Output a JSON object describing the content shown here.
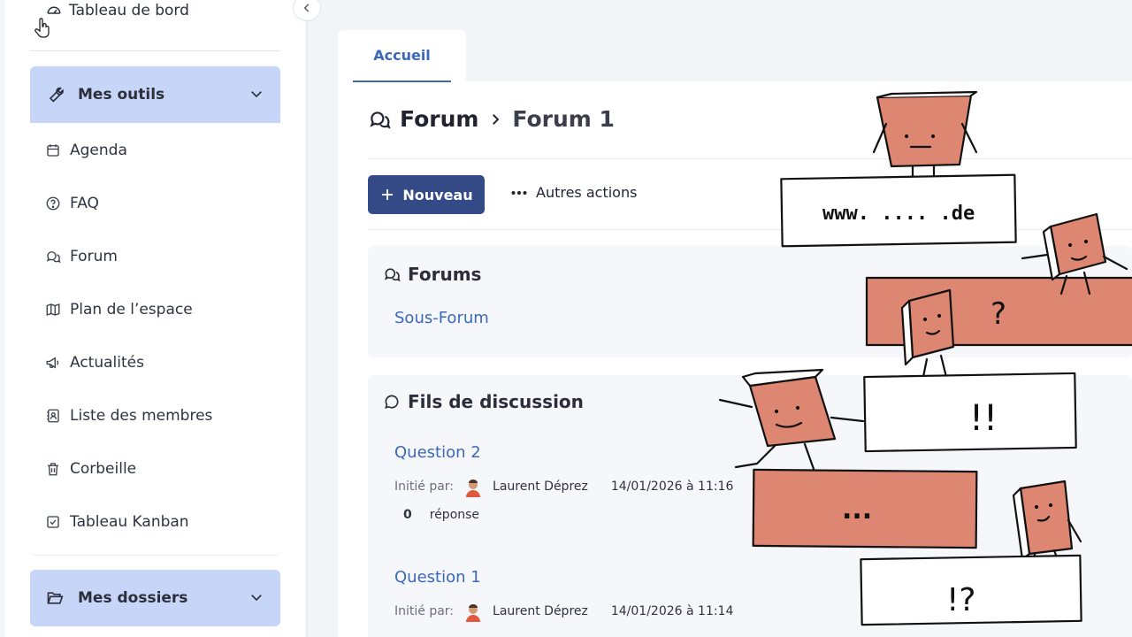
{
  "sidebar": {
    "dashboard_label": "Tableau de bord",
    "tools_label": "Mes outils",
    "tools": [
      {
        "label": "Agenda",
        "icon": "calendar-icon"
      },
      {
        "label": "FAQ",
        "icon": "question-icon"
      },
      {
        "label": "Forum",
        "icon": "chat-bubbles-icon"
      },
      {
        "label": "Plan de l’espace",
        "icon": "map-icon"
      },
      {
        "label": "Actualités",
        "icon": "megaphone-icon"
      },
      {
        "label": "Liste des membres",
        "icon": "contact-card-icon"
      },
      {
        "label": "Corbeille",
        "icon": "trash-icon"
      },
      {
        "label": "Tableau Kanban",
        "icon": "checkbox-icon"
      }
    ],
    "folders_label": "Mes dossiers"
  },
  "tabs": [
    {
      "label": "Accueil",
      "active": true
    }
  ],
  "breadcrumb": {
    "root": "Forum",
    "current": "Forum 1"
  },
  "toolbar": {
    "new_label": "Nouveau",
    "more_label": "Autres actions"
  },
  "forums_panel": {
    "title": "Forums",
    "subforum": "Sous-Forum"
  },
  "threads_panel": {
    "title": "Fils de discussion",
    "started_by_label": "Initié par:",
    "threads": [
      {
        "title": "Question 2",
        "author": "Laurent Déprez",
        "date": "14/01/2026 à 11:16",
        "reply_count": "0",
        "reply_label": "réponse"
      },
      {
        "title": "Question 1",
        "author": "Laurent Déprez",
        "date": "14/01/2026 à 11:14"
      }
    ]
  },
  "illustration": {
    "sign_text": "www. .... .de",
    "block_texts": [
      "?",
      "!!",
      "...",
      "!?"
    ]
  },
  "colors": {
    "accent": "#3b68b8",
    "primary_button": "#344a87",
    "section_head": "#c7d6f8",
    "brick": "#dd8672"
  }
}
